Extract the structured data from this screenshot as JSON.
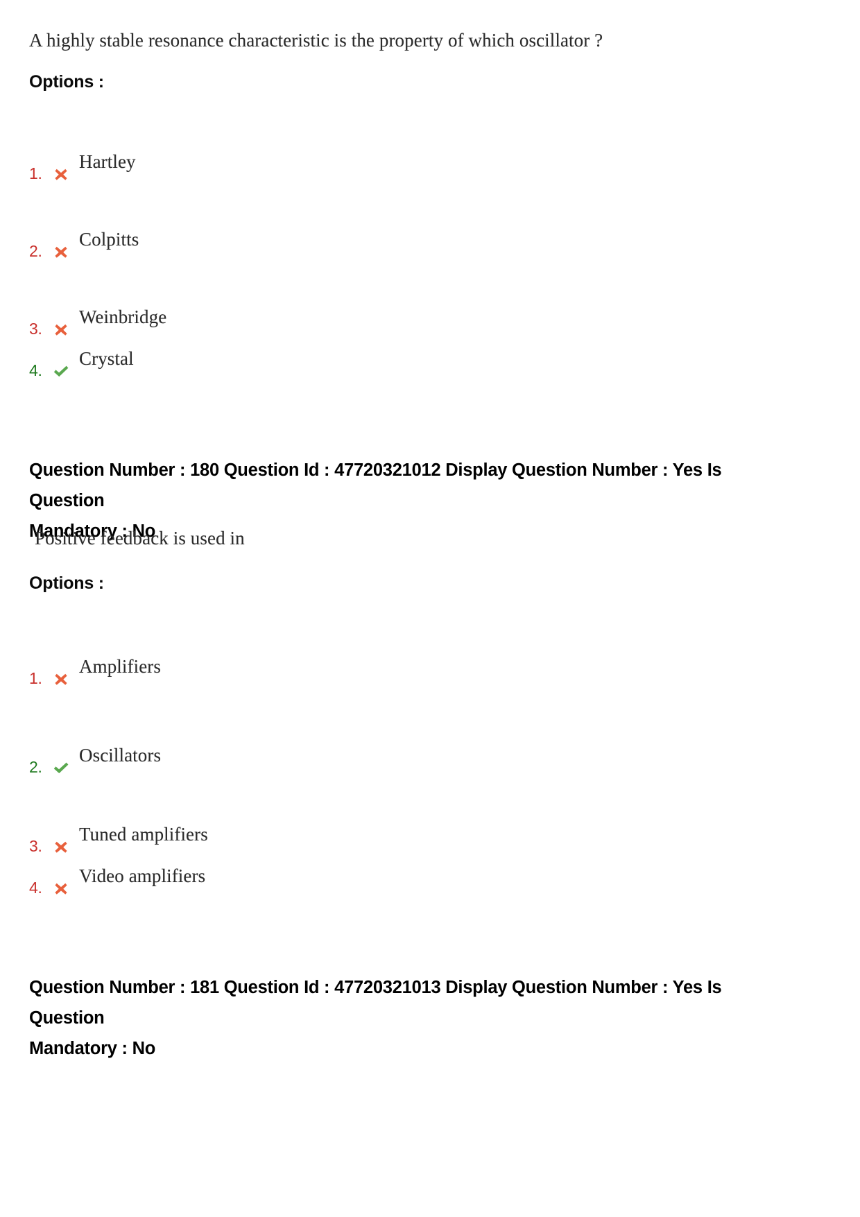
{
  "page": {
    "background_color": "#ffffff",
    "wrong_color": "#c9302c",
    "right_color": "#1f7a1f",
    "cross_icon_color": "#e8603c",
    "check_icon_color": "#5aa84f"
  },
  "questions": [
    {
      "stem": "A highly stable resonance characteristic is the property of which oscillator ?",
      "options_label": "Options :",
      "options": [
        {
          "number": "1.",
          "text": "Hartley",
          "icon": "cross-icon",
          "status": "wrong"
        },
        {
          "number": "2.",
          "text": "Colpitts",
          "icon": "cross-icon",
          "status": "wrong"
        },
        {
          "number": "3.",
          "text": "Weinbridge",
          "icon": "cross-icon",
          "status": "wrong"
        },
        {
          "number": "4.",
          "text": "Crystal",
          "icon": "check-icon",
          "status": "right"
        }
      ]
    },
    {
      "header_line1": "Question Number : 180 Question Id : 47720321012 Display Question Number : Yes Is Question",
      "header_line2": "Mandatory : No",
      "question_number": "180",
      "question_id": "47720321012",
      "display_question_number": "Yes",
      "is_question_mandatory": "No",
      "stem": "Positive feedback is used in",
      "options_label": "Options :",
      "options": [
        {
          "number": "1.",
          "text": "Amplifiers",
          "icon": "cross-icon",
          "status": "wrong"
        },
        {
          "number": "2.",
          "text": "Oscillators",
          "icon": "check-icon",
          "status": "right"
        },
        {
          "number": "3.",
          "text": "Tuned amplifiers",
          "icon": "cross-icon",
          "status": "wrong"
        },
        {
          "number": "4.",
          "text": "Video amplifiers",
          "icon": "cross-icon",
          "status": "wrong"
        }
      ]
    },
    {
      "header_line1": "Question Number : 181 Question Id : 47720321013 Display Question Number : Yes Is Question",
      "header_line2": "Mandatory : No",
      "question_number": "181",
      "question_id": "47720321013",
      "display_question_number": "Yes",
      "is_question_mandatory": "No"
    }
  ]
}
